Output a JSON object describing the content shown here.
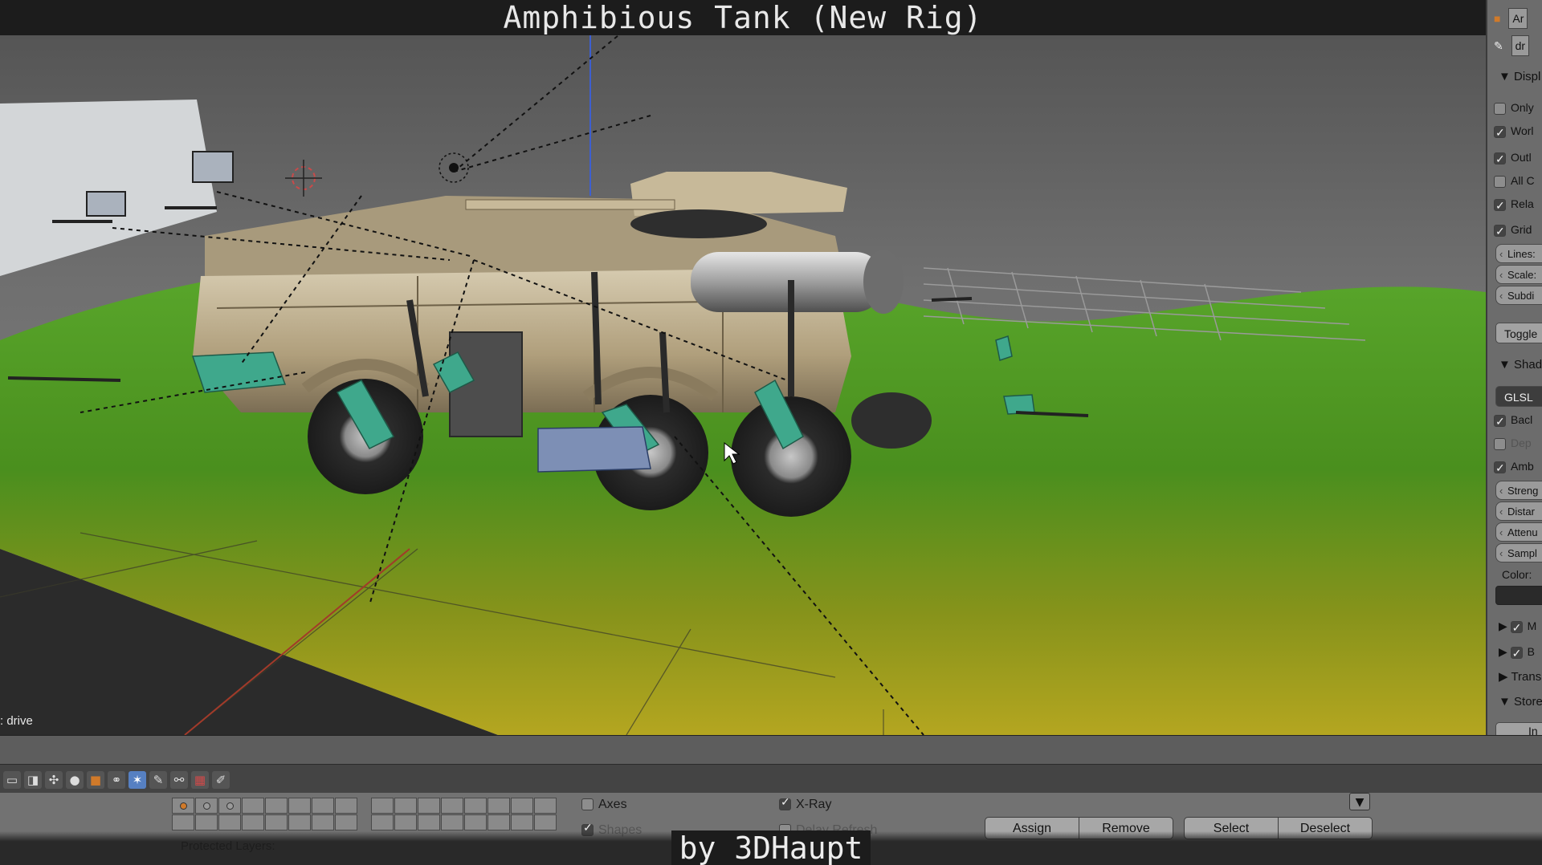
{
  "title": "Amphibious Tank (New Rig)",
  "credit": "by 3DHaupt",
  "viewport": {
    "mode_label": ": drive"
  },
  "properties": {
    "header_icons": [
      "object-icon",
      "bone-icon"
    ],
    "top_fields": [
      "Ar",
      "dr"
    ],
    "display_header": "Displ",
    "display_items": [
      {
        "label": "Only",
        "checked": false
      },
      {
        "label": "Worl",
        "checked": true
      },
      {
        "label": "Outl",
        "checked": true
      },
      {
        "label": "All C",
        "checked": false
      },
      {
        "label": "Rela",
        "checked": true
      },
      {
        "label": "Grid",
        "checked": true
      }
    ],
    "grid_fields": [
      "Lines:",
      "Scale:",
      "Subdi"
    ],
    "toggle_button": "Toggle",
    "shading_header": "Shad",
    "shading_mode": "GLSL",
    "shading_items": [
      {
        "label": "Bacl",
        "checked": true
      },
      {
        "label": "Dep",
        "checked": false
      },
      {
        "label": "Amb",
        "checked": true
      }
    ],
    "ao_fields": [
      "Streng",
      "Distar",
      "Attenu",
      "Sampl"
    ],
    "color_label": "Color:",
    "collapsed_items": [
      {
        "label": "M",
        "checked": true
      },
      {
        "label": "B",
        "checked": true
      }
    ],
    "transform_header": "Trans",
    "store_header": "Store",
    "store_button": "In"
  },
  "bottom": {
    "axes_label": "Axes",
    "shapes_label": "Shapes",
    "xray_label": "X-Ray",
    "delay_label": "Delay Refresh",
    "protected_label": "Protected Layers:",
    "buttons": {
      "assign": "Assign",
      "remove": "Remove",
      "select": "Select",
      "deselect": "Deselect"
    }
  },
  "colors": {
    "ground_green": "#5fa52a",
    "ground_yellow": "#a7a01e",
    "bone_green": "#3fa88c",
    "tank_hull": "#bcae8e",
    "accent_active": "#5680c2"
  }
}
